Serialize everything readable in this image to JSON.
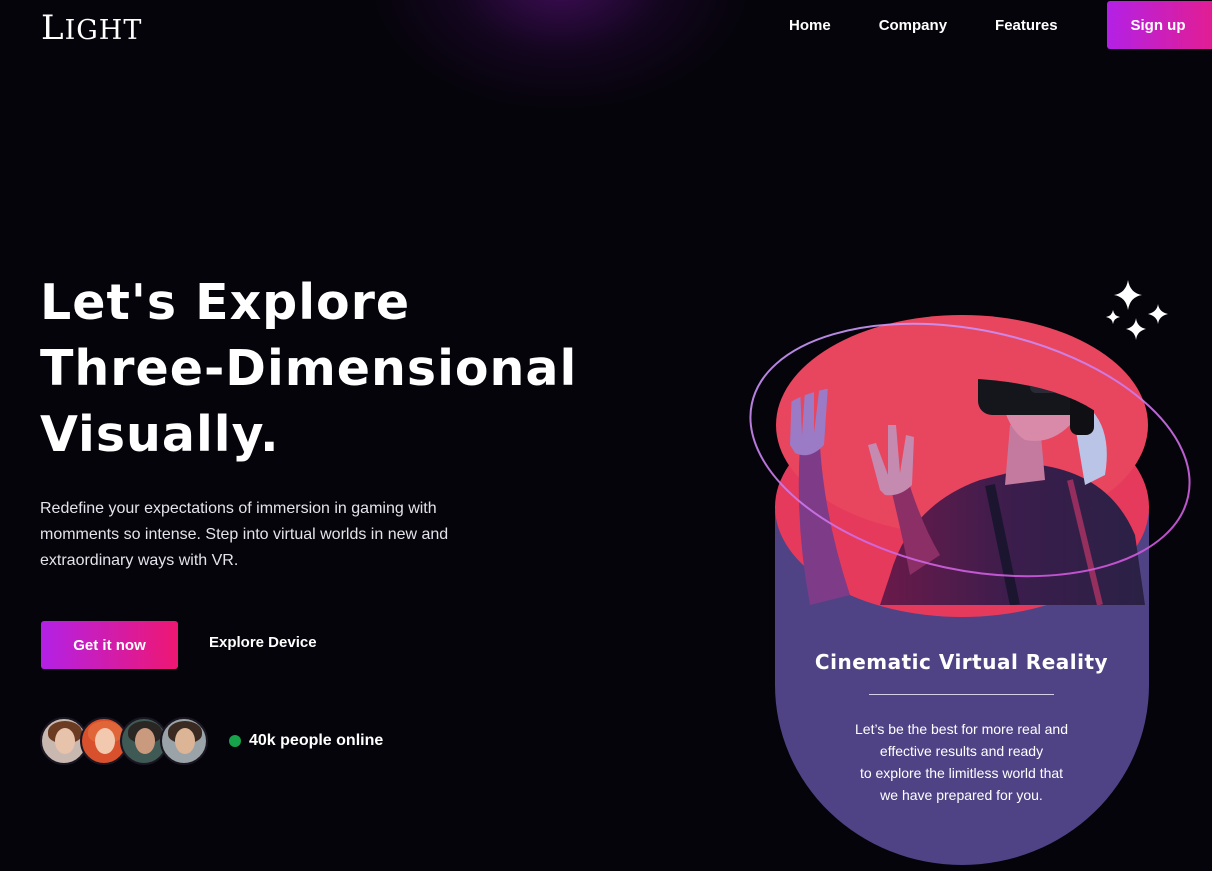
{
  "header": {
    "logo_first": "L",
    "logo_rest": "IGHT",
    "nav": [
      {
        "label": "Home"
      },
      {
        "label": "Company"
      },
      {
        "label": "Features"
      }
    ],
    "signup_label": "Sign up"
  },
  "hero": {
    "headline_lines": [
      "Let's Explore",
      "Three-Dimensional",
      "Visually."
    ],
    "description_lines": [
      "Redefine your expectations of immersion in gaming with",
      "momments so intense. Step into virtual worlds in new and",
      "extraordinary ways with VR."
    ],
    "primary_button": "Get it now",
    "secondary_button": "Explore Device",
    "online_text": "40k people online"
  },
  "card": {
    "title": "Cinematic Virtual Reality",
    "body_lines": [
      "Let’s be the best for more real and",
      "effective results and ready",
      "to explore the limitless world that",
      "we have prepared for you."
    ]
  },
  "colors": {
    "background": "#05040a",
    "accent_purple": "#b321e6",
    "accent_pink": "#e41d8f",
    "card_purple": "#4f4386",
    "card_red": "#e63a5c",
    "online_green": "#16a34a"
  },
  "icons": {
    "sparkle": "sparkle-icon",
    "online_status": "online-dot-icon"
  }
}
